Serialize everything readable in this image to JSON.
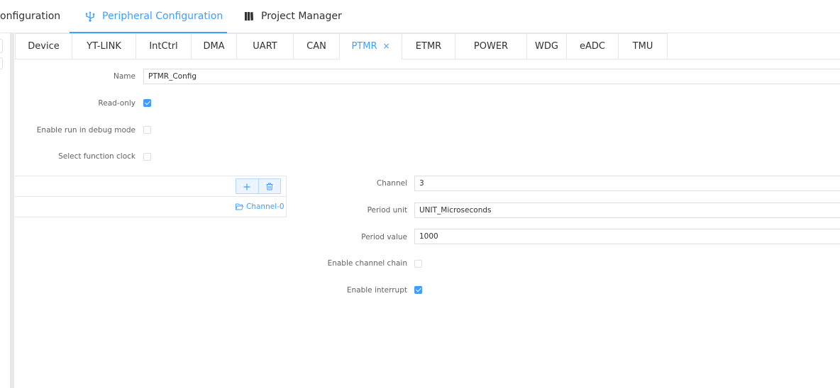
{
  "topnav": {
    "tabs": [
      {
        "label": "onfiguration",
        "icon": ""
      },
      {
        "label": "Peripheral Configuration",
        "icon": "usb-icon",
        "active": true
      },
      {
        "label": "Project Manager",
        "icon": "book-icon"
      }
    ]
  },
  "subtabs": [
    {
      "label": "Device"
    },
    {
      "label": "YT-LINK"
    },
    {
      "label": "IntCtrl"
    },
    {
      "label": "DMA"
    },
    {
      "label": "UART"
    },
    {
      "label": "CAN"
    },
    {
      "label": "PTMR",
      "active": true,
      "closable": true,
      "close_glyph": "×"
    },
    {
      "label": "ETMR"
    },
    {
      "label": "POWER"
    },
    {
      "label": "WDG"
    },
    {
      "label": "eADC"
    },
    {
      "label": "TMU"
    }
  ],
  "form": {
    "name_label": "Name",
    "name_value": "PTMR_Config",
    "readonly_label": "Read-only",
    "readonly_checked": true,
    "debug_label": "Enable run in debug mode",
    "debug_checked": false,
    "clock_label": "Select function clock",
    "clock_checked": false
  },
  "channel_list": {
    "add_icon": "plus-icon",
    "delete_icon": "trash-icon",
    "items": [
      {
        "label": "Channel-0",
        "icon": "folder-open-icon"
      }
    ]
  },
  "channel_form": {
    "channel_label": "Channel",
    "channel_value": "3",
    "period_unit_label": "Period unit",
    "period_unit_value": "UNIT_Microseconds",
    "period_value_label": "Period value",
    "period_value_value": "1000",
    "chain_label": "Enable channel chain",
    "chain_checked": false,
    "interrupt_label": "Enable interrupt",
    "interrupt_checked": true
  },
  "colors": {
    "accent": "#409eff",
    "border": "#dcdfe6",
    "text": "#303133",
    "label": "#606266"
  }
}
